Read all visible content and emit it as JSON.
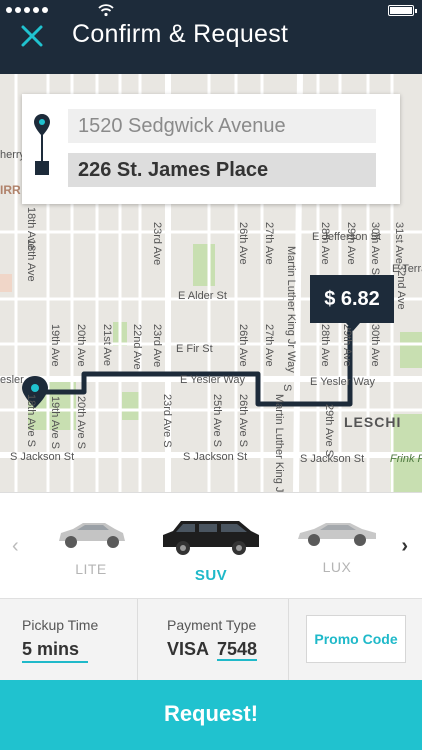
{
  "header": {
    "title": "Confirm & Request"
  },
  "status_bar": {
    "battery_level": 0.9
  },
  "address": {
    "pickup": "1520 Sedgwick Avenue",
    "destination": "226 St. James Place"
  },
  "map": {
    "labels": {
      "e_jefferson_st": "E Jefferson St",
      "e_terrace": "E Terra",
      "e_alder_st": "E Alder St",
      "e_fir_st": "E Fir St",
      "e_yesler_way": "E Yesler Way",
      "e_yesler_way_2": "E Yesler Way",
      "yesler_left": "esler",
      "s_jackson_st": "S Jackson St",
      "s_jackson_st_2": "S Jackson St",
      "s_jackson_st_3": "S Jackson St",
      "leschi": "LESCHI",
      "frink_park": "Frink P",
      "eighteenth_ave_a": "18th Ave",
      "eighteenth_ave_b": "18th Ave",
      "eighteenth_ave_s": "18th Ave S",
      "nineteenth_ave": "19th Ave",
      "nineteenth_ave_s": "19th Ave S",
      "twentieth_ave": "20th Ave",
      "twentieth_ave_s": "20th Ave S",
      "twentyfirst_ave": "21st Ave",
      "twentysecond_ave": "22nd Ave",
      "twentythird_ave": "23rd Ave",
      "twentythird_ave_s": "23rd Ave S",
      "twentyfifth_ave_s": "25th Ave S",
      "twentysixth_ave": "26th Ave",
      "twentysixth_ave_s": "26th Ave S",
      "twentyseventh_ave": "27th Ave",
      "twentyeighth_ave": "28th Ave",
      "twentyninth_ave": "29th Ave",
      "twentyninth_ave_s": "29th Ave S",
      "thirtieth_ave": "30th Ave",
      "thirtieth_ave_s": "30th Ave S",
      "thirtyfirst_ave": "31st Ave",
      "thirtysecond_ave": "32nd Ave",
      "mlk_jr_way": "Martin Luther King Jr Way",
      "mlk_jr_way_s": "Martin Luther King Jr Way S",
      "s_partial": "S",
      "cherry": "herry",
      "lirr": "IRR"
    }
  },
  "price": "$ 6.82",
  "vehicles": [
    {
      "label": "LITE",
      "active": false
    },
    {
      "label": "SUV",
      "active": true
    },
    {
      "label": "LUX",
      "active": false
    }
  ],
  "pickup_time": {
    "label": "Pickup Time",
    "value": "5 mins"
  },
  "payment": {
    "label": "Payment Type",
    "card_type": "VISA",
    "last4": "7548"
  },
  "promo_label": "Promo Code",
  "request_label": "Request!",
  "colors": {
    "navy": "#1d2b3a",
    "accent": "#20c2cf",
    "map_bg": "#e9e7e2",
    "park": "#c8dfb1"
  }
}
